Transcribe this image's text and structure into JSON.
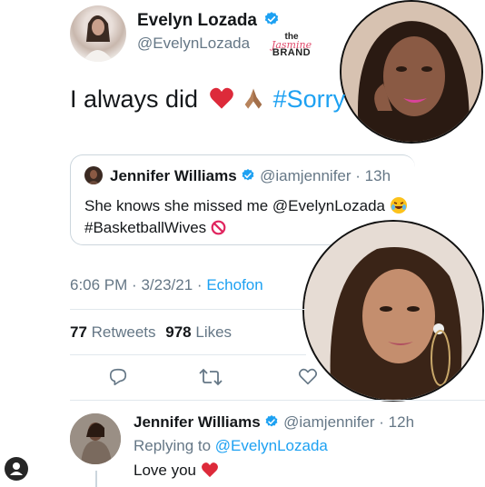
{
  "main_tweet": {
    "display_name": "Evelyn Lozada",
    "handle": "@EvelynLozada",
    "text_prefix": "I always did",
    "hashtag": "#Sorry",
    "timestamp": "6:06 PM",
    "date": "3/23/21",
    "sep": "·",
    "client": "Echofon",
    "retweets_count": "77",
    "retweets_label": "Retweets",
    "likes_count": "978",
    "likes_label": "Likes"
  },
  "watermark": {
    "line1": "the",
    "line2": "Jasmine",
    "line3": "BRAND"
  },
  "quoted_tweet": {
    "display_name": "Jennifer Williams",
    "handle": "@iamjennifer",
    "time": "· 13h",
    "text_line1": "She knows she missed me @EvelynLozada",
    "text_line2": "#BasketballWives"
  },
  "reply_tweet": {
    "display_name": "Jennifer Williams",
    "handle": "@iamjennifer",
    "time": "· 12h",
    "replying_prefix": "Replying to",
    "replying_to": "@EvelynLozada",
    "text": "Love you"
  },
  "icons": [
    "verified-badge-icon",
    "heart-emoji",
    "folded-hands-emoji",
    "laughing-emoji",
    "prohibited-emoji",
    "reply-icon",
    "retweet-icon",
    "like-icon",
    "profile-icon"
  ],
  "colors": {
    "accent": "#1da1f2",
    "grey": "#657786",
    "heart": "#e0245e"
  }
}
